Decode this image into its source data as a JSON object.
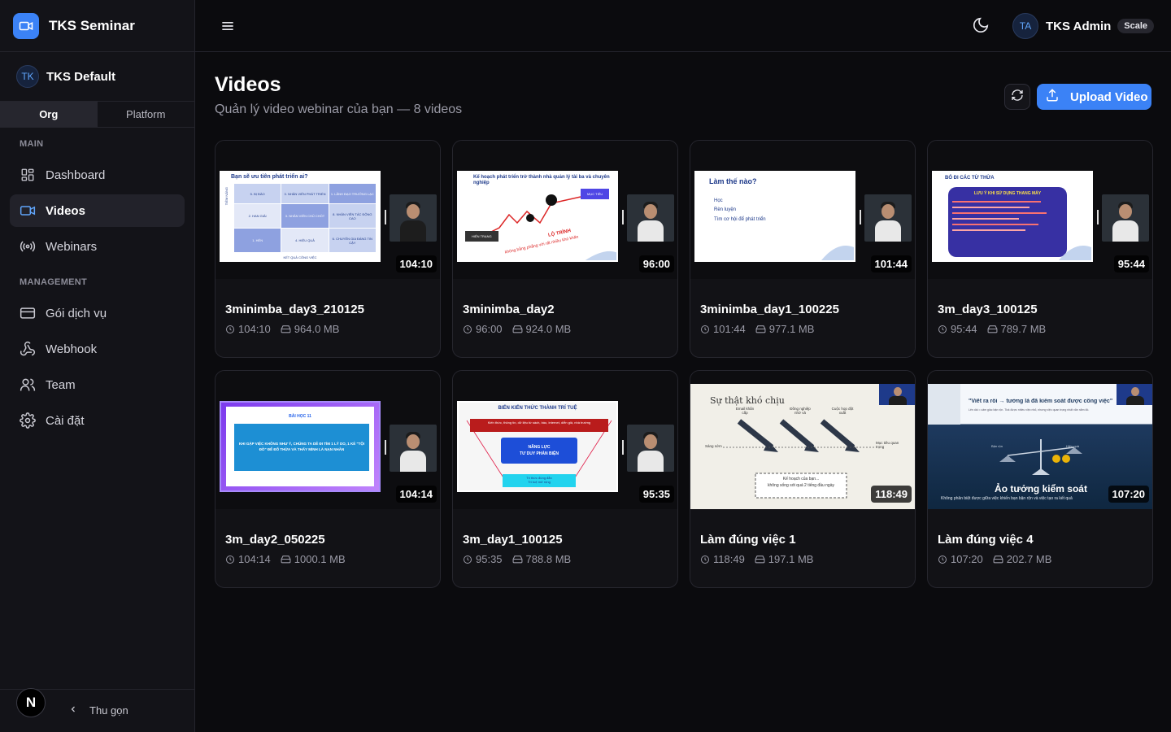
{
  "app": {
    "name": "TKS Seminar"
  },
  "workspace": {
    "initials": "TK",
    "name": "TKS Default"
  },
  "scope_tabs": [
    {
      "label": "Org",
      "active": true
    },
    {
      "label": "Platform",
      "active": false
    }
  ],
  "sidebar": {
    "main_label": "MAIN",
    "main_items": [
      {
        "label": "Dashboard",
        "icon": "dashboard-icon"
      },
      {
        "label": "Videos",
        "icon": "video-icon",
        "active": true
      },
      {
        "label": "Webinars",
        "icon": "broadcast-icon"
      }
    ],
    "management_label": "MANAGEMENT",
    "management_items": [
      {
        "label": "Gói dịch vụ",
        "icon": "card-icon"
      },
      {
        "label": "Webhook",
        "icon": "webhook-icon"
      },
      {
        "label": "Team",
        "icon": "users-icon"
      },
      {
        "label": "Cài đặt",
        "icon": "gear-icon"
      }
    ],
    "collapse_label": "Thu gọn",
    "badge": "N"
  },
  "header": {
    "user_initials": "TA",
    "user_name": "TKS Admin",
    "plan": "Scale"
  },
  "page": {
    "title": "Videos",
    "subtitle": "Quản lý video webinar của bạn — 8 videos",
    "upload_label": "Upload Video"
  },
  "colors": {
    "accent": "#3b82f6",
    "background": "#0b0b0e",
    "sidebar": "#131318"
  },
  "videos": [
    {
      "title": "3minimba_day3_210125",
      "duration": "104:10",
      "size": "964.0 MB",
      "slide": {
        "heading": "Bạn sẽ ưu tiên phát triển ai?",
        "cells": [
          "5. BỊ ĐÀO",
          "3. NHÂN VIÊN PHÁT TRIỂN",
          "1. LÃNH ĐẠO TRƯỞNG LẠC",
          "2. HAN GIẢI",
          "3. NHÂN VIÊN CHỦ CHỐT",
          "8. NHÂN VIÊN TÁC ĐỘNG CAO",
          "1. HÉN",
          "4. HIỆU QUẢ",
          "6. CHUYÊN GIA ĐÁNG TIN CẬY"
        ],
        "side": "TIỀM NĂNG",
        "footer": "KẾT QUẢ CÔNG VIỆC"
      }
    },
    {
      "title": "3minimba_day2",
      "duration": "96:00",
      "size": "924.0 MB",
      "slide": {
        "heading": "Kế hoạch phát triển trở thành nhà quản lý tài ba và chuyên nghiệp",
        "start": "HIỆN TRẠNG",
        "goal": "MỤC TIÊU",
        "path": "LỘ TRÌNH",
        "note": "không bằng phẳng với rất nhiều khó khăn"
      }
    },
    {
      "title": "3minimba_day1_100225",
      "duration": "101:44",
      "size": "977.1 MB",
      "slide": {
        "heading": "Làm thế nào?",
        "bullets": [
          "Học",
          "Rèn luyện",
          "Tìm cơ hội để phát triển"
        ]
      }
    },
    {
      "title": "3m_day3_100125",
      "duration": "95:44",
      "size": "789.7 MB",
      "slide": {
        "heading": "BỎ ĐI CÁC TỪ THỪA",
        "box_title": "LƯU Ý KHI SỬ DỤNG THANG MÁY"
      }
    },
    {
      "title": "3m_day2_050225",
      "duration": "104:14",
      "size": "1000.1 MB",
      "slide": {
        "heading": "BÀI HỌC 11",
        "body": "KHI GẶP VIỆC KHÔNG NHƯ Ý, CHÚNG TA DỄ ĐI TÌM 1 LÝ DO, 1 KẺ \"TỘI ĐỒ\" ĐỂ ĐỔ THỪA VÀ THẤY MÌNH LÀ NẠN NHÂN"
      }
    },
    {
      "title": "3m_day1_100125",
      "duration": "95:35",
      "size": "788.8 MB",
      "slide": {
        "heading": "BIẾN KIẾN THỨC THÀNH TRÍ TUỆ",
        "top": "Kiến thức, thông tin, dữ liệu từ sách, báo, internet, diễn giả, nhà trường",
        "middle1": "NĂNG LỰC",
        "middle2": "TƯ DUY PHẢN BIỆN",
        "bottom1": "Tri thức đúng đắn",
        "bottom2": "Trí tuệ mở rộng"
      }
    },
    {
      "title": "Làm đúng việc 1",
      "duration": "118:49",
      "size": "197.1 MB",
      "slide": {
        "heading": "Sự thật khó chịu",
        "labels": [
          "Email khẩn cấp",
          "Đồng nghiệp nhờ vả",
          "Cuộc họp đột xuất",
          "Sáng sớm",
          "Mục tiêu quan trọng"
        ],
        "caption1": "Kế hoạch của bạn...",
        "caption2": "không sống sót quá 2 tiếng đầu ngày"
      }
    },
    {
      "title": "Làm đúng việc 4",
      "duration": "107:20",
      "size": "202.7 MB",
      "slide": {
        "heading": "\"Viết ra rồi → tưởng là đã kiểm soát được công việc\"",
        "sub": "Lên dài = cảm giác bận rộn. Tick được nhiều việc nhỏ, nhưng việc quan trọng nhất vẫn nằm đó.",
        "left": "Bận rộn",
        "right": "Hiệu quả",
        "big": "Ảo tưởng kiểm soát",
        "caption": "Không phân biệt được giữa việc khiến bạn bận rộn và việc tạo ra kết quả"
      }
    }
  ]
}
